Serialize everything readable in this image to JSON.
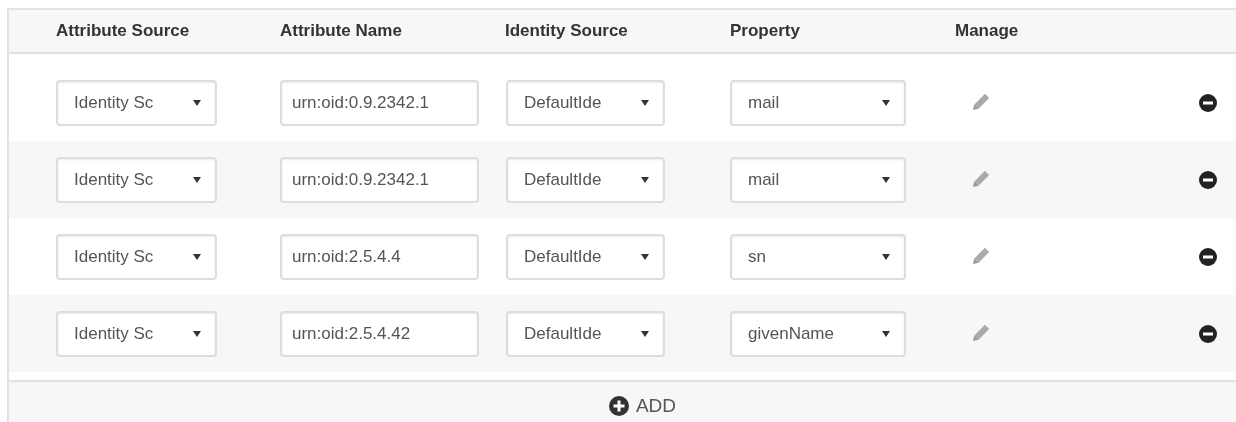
{
  "table": {
    "columns": [
      "Attribute Source",
      "Attribute Name",
      "Identity Source",
      "Property",
      "Manage"
    ],
    "rows": [
      {
        "attribute_source": "Identity Sc",
        "attribute_name": "urn:oid:0.9.2342.1",
        "identity_source": "DefaultIde",
        "property": "mail"
      },
      {
        "attribute_source": "Identity Sc",
        "attribute_name": "urn:oid:0.9.2342.1",
        "identity_source": "DefaultIde",
        "property": "mail"
      },
      {
        "attribute_source": "Identity Sc",
        "attribute_name": "urn:oid:2.5.4.4",
        "identity_source": "DefaultIde",
        "property": "sn"
      },
      {
        "attribute_source": "Identity Sc",
        "attribute_name": "urn:oid:2.5.4.42",
        "identity_source": "DefaultIde",
        "property": "givenName"
      }
    ]
  },
  "add_button": {
    "label": "ADD"
  }
}
